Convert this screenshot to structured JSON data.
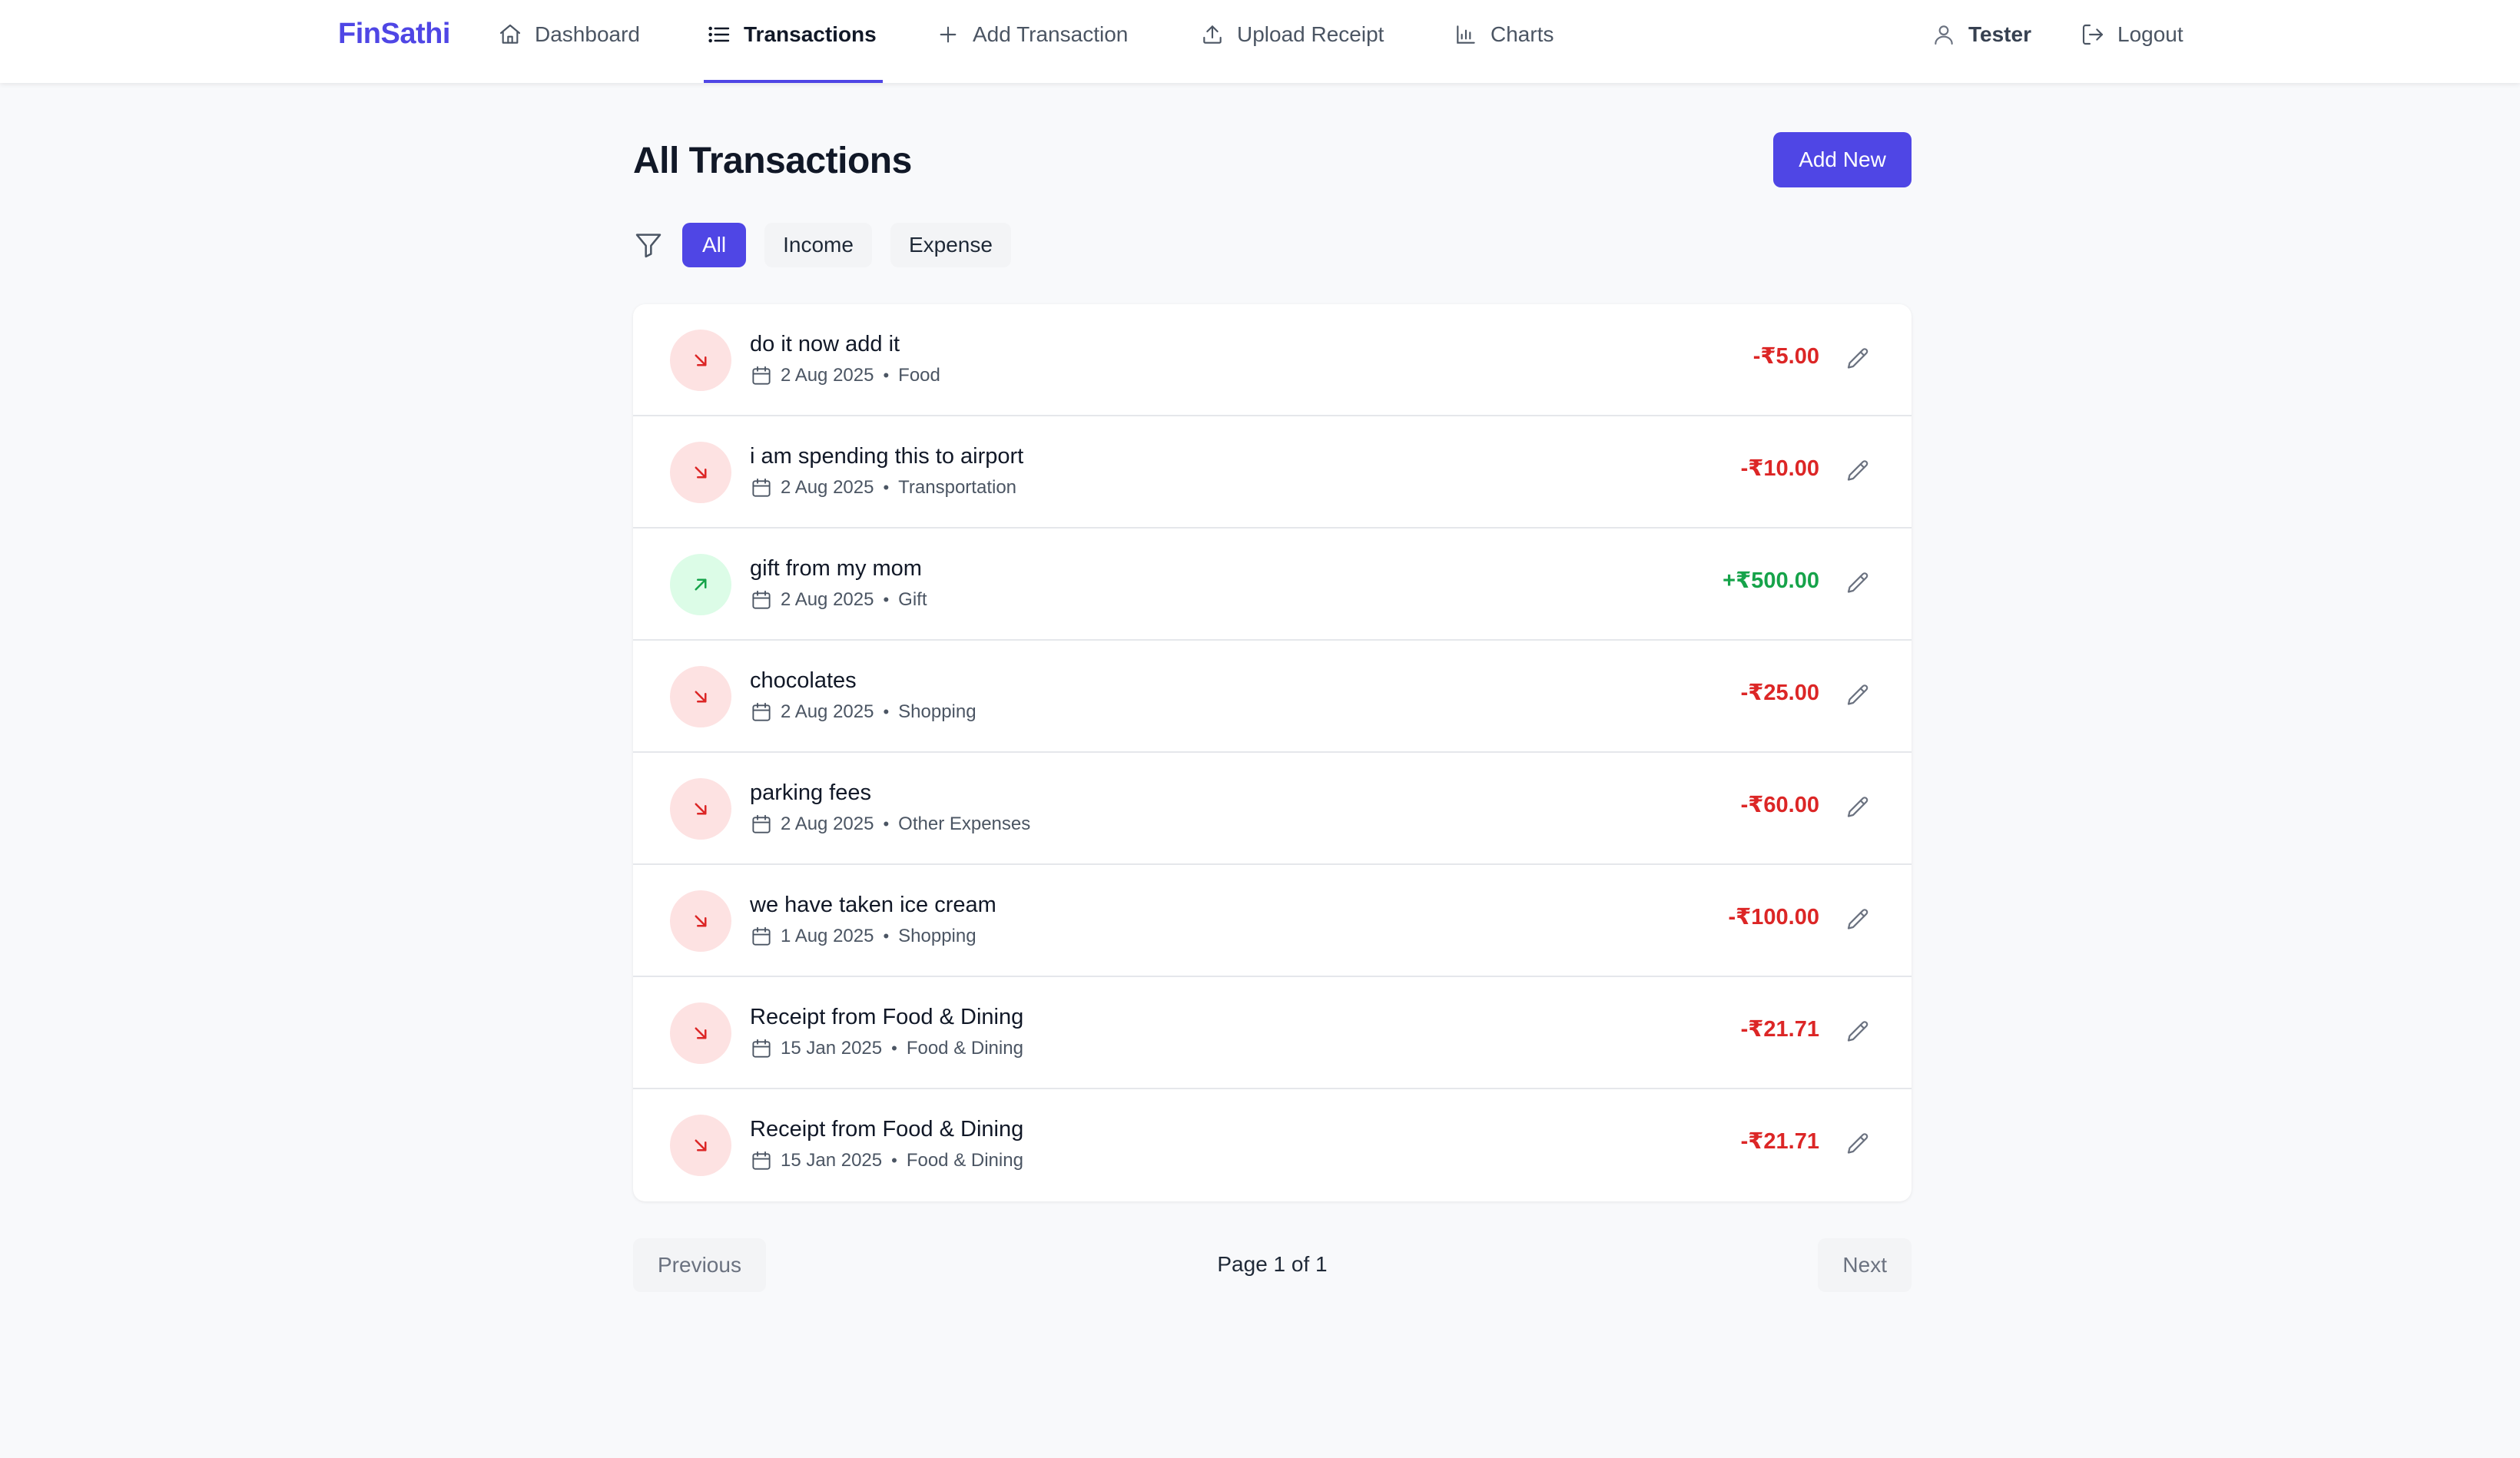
{
  "app": {
    "brand": "FinSathi"
  },
  "nav": {
    "dashboard": "Dashboard",
    "transactions": "Transactions",
    "add_transaction": "Add Transaction",
    "upload_receipt": "Upload Receipt",
    "charts": "Charts",
    "user": "Tester",
    "logout": "Logout"
  },
  "page": {
    "title": "All Transactions",
    "add_new": "Add New"
  },
  "filters": {
    "all": "All",
    "income": "Income",
    "expense": "Expense",
    "active": "All"
  },
  "colors": {
    "accent": "#4f46e5",
    "expense": "#dc2626",
    "income": "#16a34a"
  },
  "transactions": [
    {
      "type": "expense",
      "description": "do it now add it",
      "date": "2 Aug 2025",
      "category": "Food",
      "amount": "-₹5.00"
    },
    {
      "type": "expense",
      "description": "i am spending this to airport",
      "date": "2 Aug 2025",
      "category": "Transportation",
      "amount": "-₹10.00"
    },
    {
      "type": "income",
      "description": "gift from my mom",
      "date": "2 Aug 2025",
      "category": "Gift",
      "amount": "+₹500.00"
    },
    {
      "type": "expense",
      "description": "chocolates",
      "date": "2 Aug 2025",
      "category": "Shopping",
      "amount": "-₹25.00"
    },
    {
      "type": "expense",
      "description": "parking fees",
      "date": "2 Aug 2025",
      "category": "Other Expenses",
      "amount": "-₹60.00"
    },
    {
      "type": "expense",
      "description": "we have taken ice cream",
      "date": "1 Aug 2025",
      "category": "Shopping",
      "amount": "-₹100.00"
    },
    {
      "type": "expense",
      "description": "Receipt from Food & Dining",
      "date": "15 Jan 2025",
      "category": "Food & Dining",
      "amount": "-₹21.71"
    },
    {
      "type": "expense",
      "description": "Receipt from Food & Dining",
      "date": "15 Jan 2025",
      "category": "Food & Dining",
      "amount": "-₹21.71"
    }
  ],
  "pagination": {
    "previous": "Previous",
    "info": "Page 1 of 1",
    "next": "Next"
  }
}
